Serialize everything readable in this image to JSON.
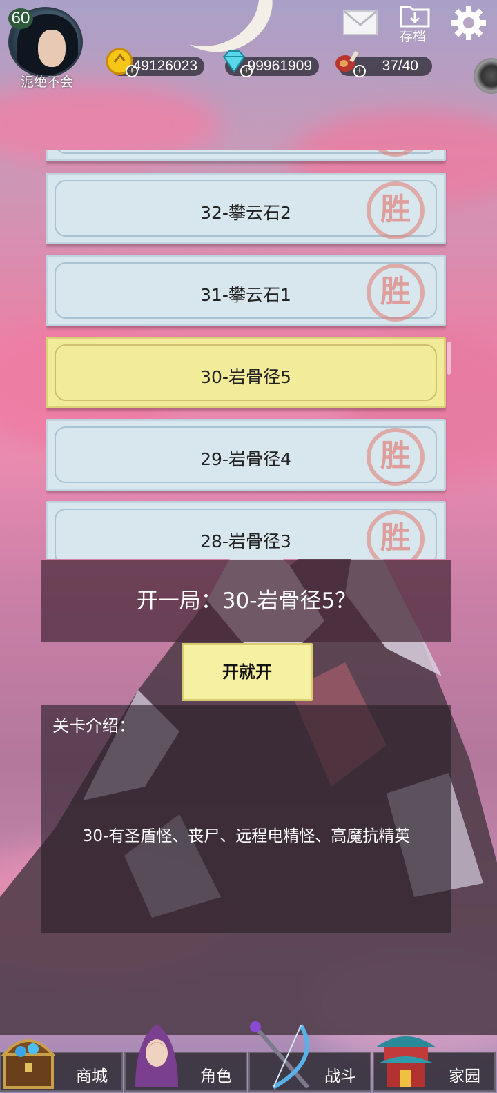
{
  "player": {
    "level": "60",
    "name": "泥绝不会"
  },
  "resources": {
    "gold": {
      "icon": "gold-coin-icon",
      "value": "49126023"
    },
    "gems": {
      "icon": "diamond-icon",
      "value": "99961909"
    },
    "stamina": {
      "icon": "meat-icon",
      "value": "37/40"
    }
  },
  "top_actions": {
    "mail_icon": "mail-icon",
    "save_label": "存档",
    "settings_icon": "gear-icon"
  },
  "stages": [
    {
      "label": "",
      "cleared": true,
      "stamp": "胜"
    },
    {
      "label": "32-攀云石2",
      "cleared": true,
      "stamp": "胜"
    },
    {
      "label": "31-攀云石1",
      "cleared": true,
      "stamp": "胜"
    },
    {
      "label": "30-岩骨径5",
      "cleared": false,
      "selected": true
    },
    {
      "label": "29-岩骨径4",
      "cleared": true,
      "stamp": "胜"
    },
    {
      "label": "28-岩骨径3",
      "cleared": true,
      "stamp": "胜"
    }
  ],
  "dialog": {
    "prompt": "开一局：30-岩骨径5？",
    "confirm_label": "开就开",
    "intro_title": "关卡介绍：",
    "intro_text": "30-有圣盾怪、丧尸、远程电精怪、高魔抗精英"
  },
  "nav": [
    {
      "label": "商城",
      "icon": "treasure-chest-icon"
    },
    {
      "label": "角色",
      "icon": "hooded-hero-icon"
    },
    {
      "label": "战斗",
      "icon": "crossed-weapons-icon"
    },
    {
      "label": "家园",
      "icon": "pavilion-icon"
    }
  ],
  "colors": {
    "selected_stage": "#f2ec9a",
    "stage": "#d8e6ee",
    "button": "#f6f0a2"
  }
}
